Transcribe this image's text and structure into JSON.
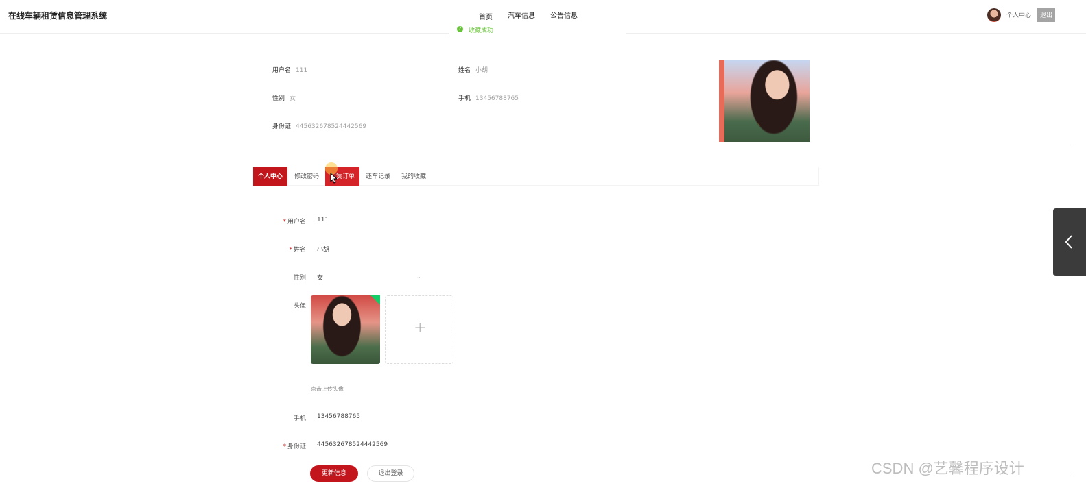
{
  "header": {
    "app_title": "在线车辆租赁信息管理系统",
    "nav": [
      "首页",
      "汽车信息",
      "公告信息"
    ],
    "user_center": "个人中心",
    "logout": "退出"
  },
  "toast": {
    "message": "收藏成功",
    "status_color": "#67c23a"
  },
  "profile_summary": {
    "username_label": "用户名",
    "username": "111",
    "name_label": "姓名",
    "name": "小胡",
    "gender_label": "性别",
    "gender": "女",
    "phone_label": "手机",
    "phone": "13456788765",
    "id_label": "身份证",
    "id_number": "445632678524442569"
  },
  "tabs": [
    {
      "label": "个人中心",
      "active": true
    },
    {
      "label": "修改密码"
    },
    {
      "label": "租赁订单",
      "hover": true
    },
    {
      "label": "还车记录"
    },
    {
      "label": "我的收藏"
    }
  ],
  "form": {
    "username_label": "用户名",
    "username": "111",
    "name_label": "姓名",
    "name": "小胡",
    "gender_label": "性别",
    "gender": "女",
    "avatar_label": "头像",
    "upload_tip": "点击上传头像",
    "phone_label": "手机",
    "phone": "13456788765",
    "id_label": "身份证",
    "id_number": "445632678524442569"
  },
  "buttons": {
    "update": "更新信息",
    "logout": "退出登录"
  },
  "watermark": "CSDN @艺馨程序设计",
  "colors": {
    "accent": "#c3161c",
    "success": "#67c23a",
    "toggle_bg": "#3b3b3b"
  }
}
